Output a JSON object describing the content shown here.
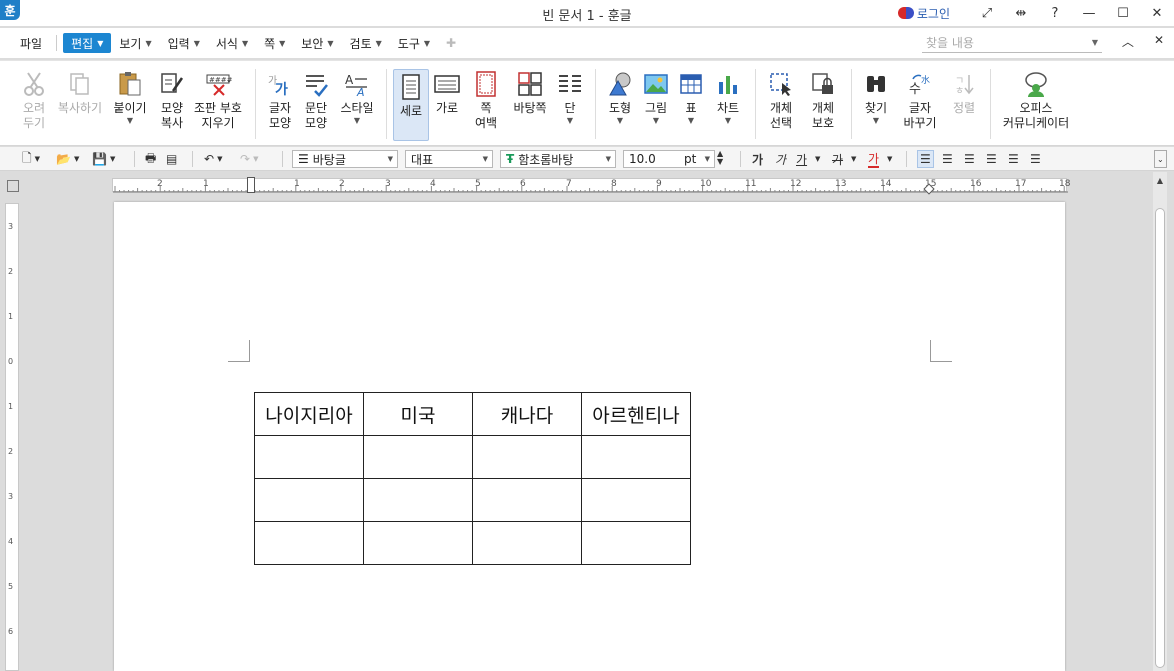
{
  "titlebar": {
    "logo": "훈",
    "title": "빈 문서 1 - 훈글",
    "login": "로그인"
  },
  "menubar": {
    "items": [
      {
        "label": "파일"
      },
      {
        "label": "편집"
      },
      {
        "label": "보기"
      },
      {
        "label": "입력"
      },
      {
        "label": "서식"
      },
      {
        "label": "쪽"
      },
      {
        "label": "보안"
      },
      {
        "label": "검토"
      },
      {
        "label": "도구"
      }
    ],
    "search_placeholder": "찾을 내용"
  },
  "ribbon": {
    "cut": {
      "line1": "오려",
      "line2": "두기"
    },
    "copy": {
      "line1": "복사하기"
    },
    "paste": {
      "line1": "붙이기"
    },
    "format_copy": {
      "line1": "모양",
      "line2": "복사"
    },
    "erase_marks": {
      "line1": "조판 부호",
      "line2": "지우기"
    },
    "char_shape": {
      "line1": "글자",
      "line2": "모양"
    },
    "para_shape": {
      "line1": "문단",
      "line2": "모양"
    },
    "style": {
      "line1": "스타일"
    },
    "portrait": {
      "line1": "세로"
    },
    "landscape": {
      "line1": "가로"
    },
    "page_margin": {
      "line1": "쪽",
      "line2": "여백"
    },
    "master_page": {
      "line1": "바탕쪽"
    },
    "columns": {
      "line1": "단"
    },
    "shape": {
      "line1": "도형"
    },
    "picture": {
      "line1": "그림"
    },
    "table": {
      "line1": "표"
    },
    "chart": {
      "line1": "차트"
    },
    "object_select": {
      "line1": "개체",
      "line2": "선택"
    },
    "object_protect": {
      "line1": "개체",
      "line2": "보호"
    },
    "find": {
      "line1": "찾기"
    },
    "replace_char": {
      "line1": "글자",
      "line2": "바꾸기"
    },
    "sort": {
      "line1": "정렬"
    },
    "office_comm": {
      "line1": "오피스",
      "line2": "커뮤니케이터"
    }
  },
  "format": {
    "style_name": "바탕글",
    "lang": "대표",
    "font": "함초롬바탕",
    "size": "10.0",
    "unit": "pt",
    "bold": "가",
    "italic": "가",
    "underline": "가",
    "strike": "가",
    "font_color": "가"
  },
  "ruler": {
    "h": [
      "2",
      "1",
      "1",
      "2",
      "3",
      "4",
      "5",
      "6",
      "7",
      "8",
      "9",
      "10",
      "11",
      "12",
      "13",
      "14",
      "15",
      "16",
      "17",
      "18"
    ],
    "v": [
      "3",
      "2",
      "1",
      "0",
      "1",
      "2",
      "3",
      "4",
      "5",
      "6"
    ]
  },
  "document": {
    "table": [
      [
        "나이지리아",
        "미국",
        "캐나다",
        "아르헨티나"
      ],
      [
        "",
        "",
        "",
        ""
      ],
      [
        "",
        "",
        "",
        ""
      ],
      [
        "",
        "",
        "",
        ""
      ]
    ]
  }
}
